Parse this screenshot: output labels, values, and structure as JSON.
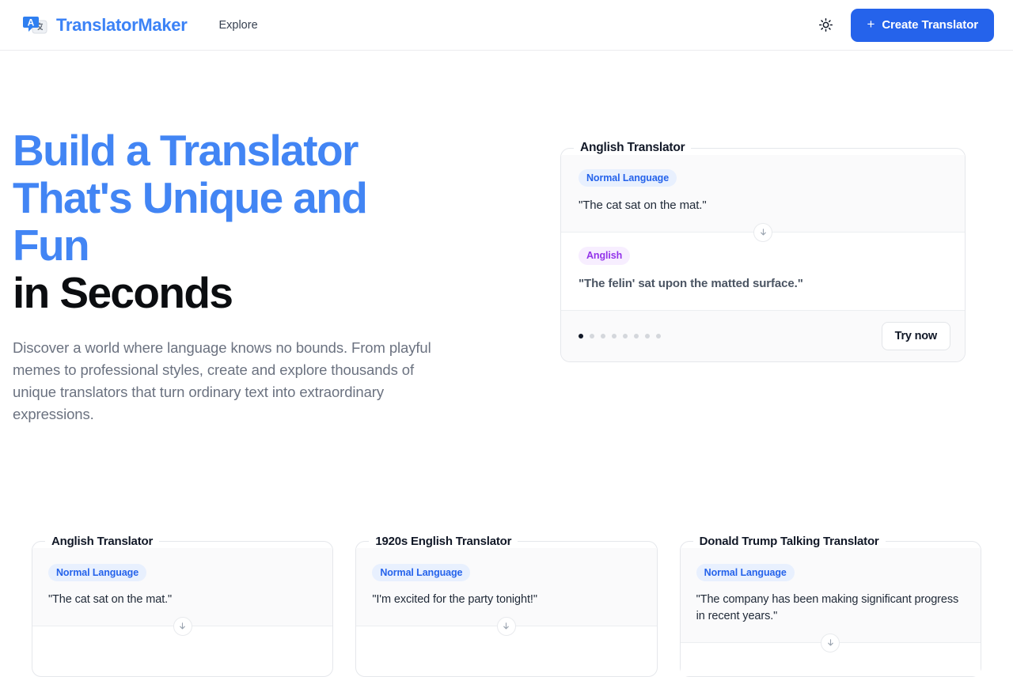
{
  "header": {
    "brand_name": "TranslatorMaker",
    "logo_icon": "translate-logo-icon",
    "nav": [
      {
        "label": "Explore",
        "name": "nav-explore"
      }
    ],
    "theme_toggle_icon": "sun-icon",
    "create_button": {
      "label": "Create Translator",
      "plus": "+",
      "color": "#2563eb"
    }
  },
  "hero": {
    "headline_line1": "Build a Translator",
    "headline_line2": "That's Unique and",
    "headline_line3": "Fun",
    "headline_line4": "in Seconds",
    "headline_accent_color": "#4285f4",
    "headline_plain_color": "#0b0d10",
    "subtext": "Discover a world where language knows no bounds. From playful memes to professional styles, create and explore thousands of unique translators that turn ordinary text into extraordinary expressions.",
    "card": {
      "title": "Anglish Translator",
      "input_badge": "Normal Language",
      "input_text": "\"The cat sat on the mat.\"",
      "output_badge": "Anglish",
      "output_text": "\"The felin' sat upon the matted surface.\"",
      "arrow_icon": "arrow-down-icon",
      "dots_total": 8,
      "dots_active_index": 0,
      "try_button_label": "Try now"
    }
  },
  "gallery": {
    "cards": [
      {
        "title": "Anglish Translator",
        "input_badge": "Normal Language",
        "input_text": "\"The cat sat on the mat.\"",
        "arrow_icon": "arrow-down-icon"
      },
      {
        "title": "1920s English Translator",
        "input_badge": "Normal Language",
        "input_text": "\"I'm excited for the party tonight!\"",
        "arrow_icon": "arrow-down-icon"
      },
      {
        "title": "Donald Trump Talking Translator",
        "input_badge": "Normal Language",
        "input_text": "\"The company has been making significant progress in recent years.\"",
        "arrow_icon": "arrow-down-icon"
      }
    ]
  },
  "colors": {
    "accent_blue": "#2563eb",
    "headline_blue": "#4285f4",
    "badge_normal_bg": "#e8f0fe",
    "badge_normal_fg": "#2563eb",
    "badge_style_bg": "#f7eeff",
    "badge_style_fg": "#9333ea"
  }
}
